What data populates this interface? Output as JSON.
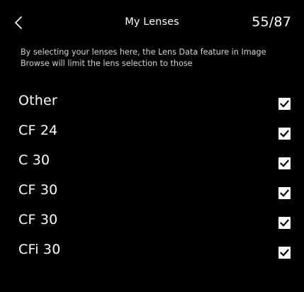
{
  "header": {
    "back_icon": "chevron-left-icon",
    "title": "My Lenses",
    "counter": "55/87"
  },
  "description": {
    "line1": "By selecting your lenses here, the Lens Data feature in Image",
    "line2": "Browse will limit the lens selection to those"
  },
  "lenses": [
    {
      "label": "Other",
      "checked": true
    },
    {
      "label": "CF 24",
      "checked": true
    },
    {
      "label": "C 30",
      "checked": true
    },
    {
      "label": "CF 30",
      "checked": true
    },
    {
      "label": "CF 30",
      "checked": true
    },
    {
      "label": "CFi 30",
      "checked": true
    }
  ],
  "colors": {
    "background": "#000000",
    "text": "#ffffff",
    "description_text": "#d6d6d6",
    "checkbox_fill": "#ffffff",
    "checkmark": "#000000"
  }
}
